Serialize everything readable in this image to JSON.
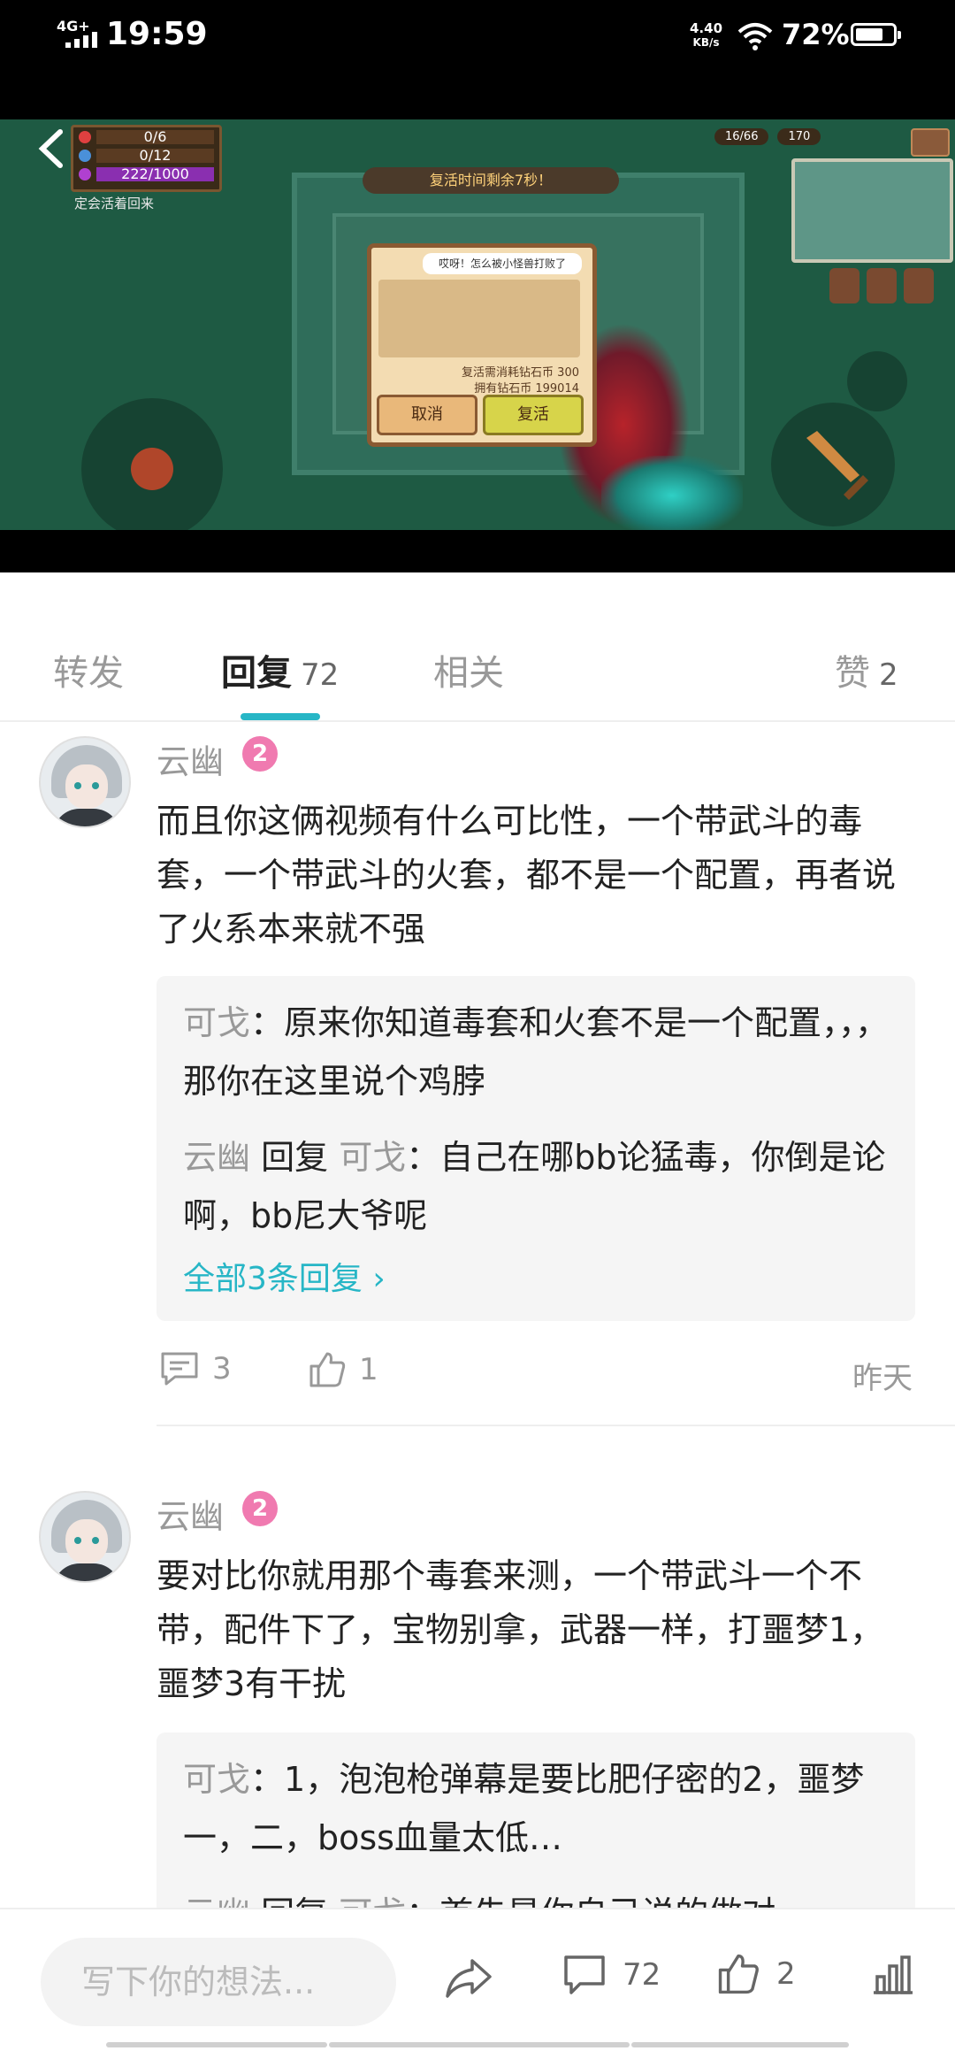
{
  "status_bar": {
    "network": "4G+",
    "time": "19:59",
    "speed_value": "4.40",
    "speed_unit": "KB/s",
    "battery": "72%"
  },
  "video": {
    "hud_hp": "0/6",
    "hud_shield": "0/12",
    "hud_energy": "222/1000",
    "hud_note": "定会活着回来",
    "revive_banner": "复活时间剩余7秒！",
    "dialog_bubble": "哎呀！怎么被小怪兽打败了",
    "dialog_cost": "复活需消耗钻石币 300",
    "dialog_own": "拥有钻石币 199014",
    "cancel_label": "取消",
    "revive_label": "复活",
    "res_left": "16/66",
    "res_right": "170"
  },
  "tabs": [
    {
      "label": "转发",
      "count": ""
    },
    {
      "label": "回复",
      "count": "72"
    },
    {
      "label": "相关",
      "count": ""
    },
    {
      "label": "赞",
      "count": "2"
    }
  ],
  "comments": [
    {
      "user": "云幽",
      "level": "2",
      "text": "而且你这俩视频有什么可比性，一个带武斗的毒套，一个带武斗的火套，都不是一个配置，再者说了火系本来就不强",
      "replies": [
        {
          "author": "可戈",
          "reply_word": "",
          "target": "",
          "text": "：原来你知道毒套和火套不是一个配置，，，那你在这里说个鸡脖"
        },
        {
          "author": "云幽",
          "reply_word": "回复",
          "target": "可戈",
          "text": "：自己在哪bb论猛毒，你倒是论啊，bb尼大爷呢"
        }
      ],
      "more_replies": "全部3条回复 ›",
      "reply_count": "3",
      "like_count": "1",
      "time": "昨天"
    },
    {
      "user": "云幽",
      "level": "2",
      "text": "要对比你就用那个毒套来测，一个带武斗一个不带，配件下了，宝物别拿，武器一样，打噩梦1，噩梦3有干扰",
      "replies": [
        {
          "author": "可戈",
          "reply_word": "",
          "target": "",
          "text": "：1，泡泡枪弹幕是要比肥仔密的2，噩梦一，二，boss血量太低…"
        },
        {
          "author": "云幽",
          "reply_word": "回复",
          "target": "可戈",
          "text": "：首先是你自己说的做对"
        }
      ]
    }
  ],
  "bottom_bar": {
    "input_placeholder": "写下你的想法...",
    "comment_count": "72",
    "like_count": "2"
  },
  "colors": {
    "accent": "#27b6c6",
    "level_badge": "#f07ab0"
  }
}
